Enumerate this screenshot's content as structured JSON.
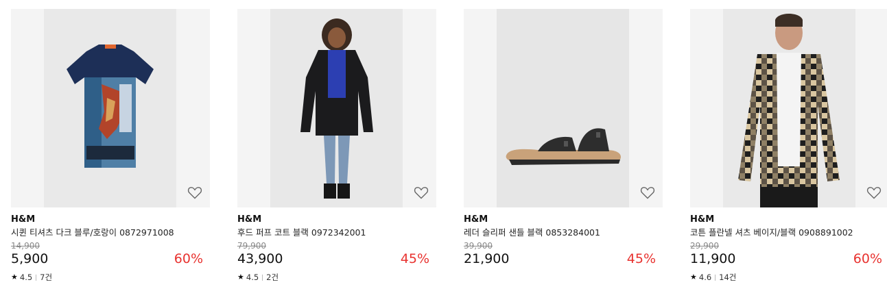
{
  "products": [
    {
      "brand": "H&M",
      "name": "시퀸 티셔츠 다크 블루/호랑이 0872971008",
      "original_price": "14,900",
      "price": "5,900",
      "discount": "60%",
      "rating": "4.5",
      "reviews": "7건",
      "image": "navy-tiger-sequin-tshirt"
    },
    {
      "brand": "H&M",
      "name": "후드 퍼프 코트 블랙 0972342001",
      "original_price": "79,900",
      "price": "43,900",
      "discount": "45%",
      "rating": "4.5",
      "reviews": "2건",
      "image": "woman-black-puffer-coat"
    },
    {
      "brand": "H&M",
      "name": "레더 슬리퍼 샌들 블랙 0853284001",
      "original_price": "39,900",
      "price": "21,900",
      "discount": "45%",
      "rating": "",
      "reviews": "",
      "image": "black-two-strap-sandal"
    },
    {
      "brand": "H&M",
      "name": "코튼 플란넬 셔츠 베이지/블랙 0908891002",
      "original_price": "29,900",
      "price": "11,900",
      "discount": "60%",
      "rating": "4.6",
      "reviews": "14건",
      "image": "man-beige-black-check-shirt"
    }
  ],
  "colors": {
    "discount": "#e8322f",
    "image_background": "#f4f4f4"
  },
  "icons": {
    "wishlist": "heart-outline-icon",
    "rating": "star-icon"
  }
}
